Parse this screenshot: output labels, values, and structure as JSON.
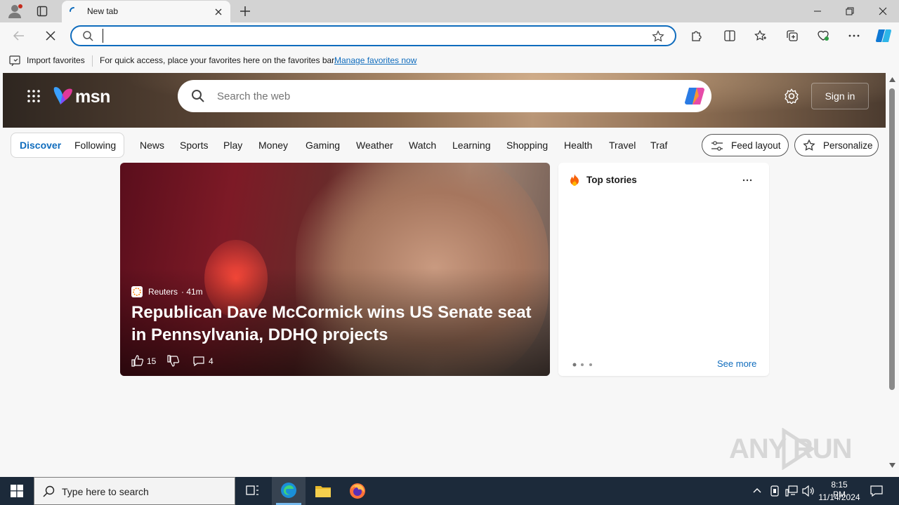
{
  "browser": {
    "tab_title": "New tab",
    "address_value": "",
    "favorites_bar": {
      "import_label": "Import favorites",
      "hint_text": "For quick access, place your favorites here on the favorites bar.",
      "manage_link": "Manage favorites now"
    }
  },
  "msn": {
    "logo_text": "msn",
    "search_placeholder": "Search the web",
    "sign_in_label": "Sign in",
    "tabs": [
      "Discover",
      "Following"
    ],
    "nav_links": [
      "News",
      "Sports",
      "Play",
      "Money",
      "Gaming",
      "Weather",
      "Watch",
      "Learning",
      "Shopping",
      "Health",
      "Travel",
      "Traf"
    ],
    "feed_layout_label": "Feed layout",
    "personalize_label": "Personalize"
  },
  "hero_story": {
    "source": "Reuters",
    "age": "· 41m",
    "headline": "Republican Dave McCormick wins US Senate seat in Pennsylvania, DDHQ projects",
    "likes": "15",
    "comments": "4"
  },
  "top_stories": {
    "title": "Top stories",
    "see_more": "See more"
  },
  "watermark": "ANY RUN",
  "taskbar": {
    "search_placeholder": "Type here to search",
    "time": "8:15 PM",
    "date": "11/14/2024"
  },
  "colors": {
    "accent": "#0f6cbd",
    "taskbar": "#1c2a3a"
  }
}
